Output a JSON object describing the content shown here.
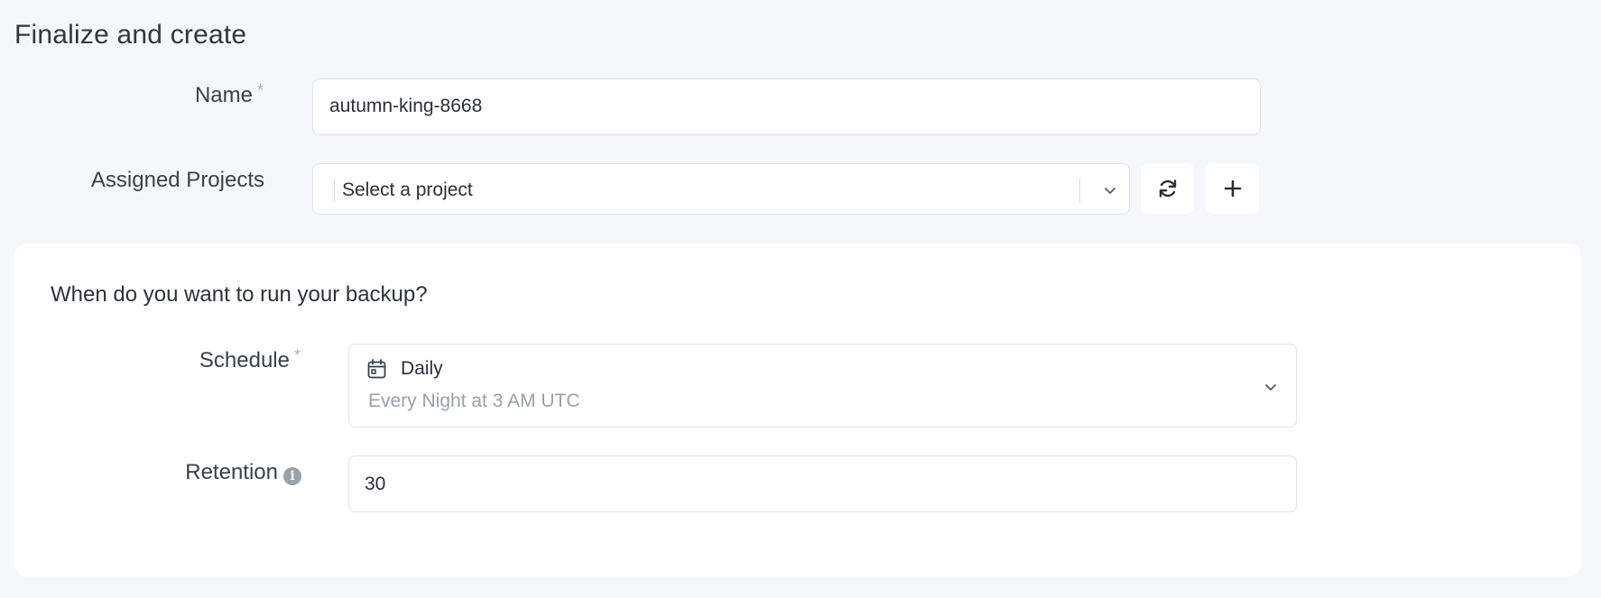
{
  "page": {
    "title": "Finalize and create"
  },
  "name_field": {
    "label": "Name",
    "required_mark": "*",
    "value": "autumn-king-8668"
  },
  "projects_field": {
    "label": "Assigned Projects",
    "placeholder": "Select a project",
    "refresh_icon": "refresh-icon",
    "add_icon": "plus-icon"
  },
  "backup_section": {
    "title": "When do you want to run your backup?",
    "schedule": {
      "label": "Schedule",
      "required_mark": "*",
      "icon": "calendar-icon",
      "selected_value": "Daily",
      "description": "Every Night at 3 AM UTC"
    },
    "retention": {
      "label": "Retention",
      "info_icon": "info-icon",
      "value": "30"
    }
  },
  "colors": {
    "page_background": "#f5f7fa",
    "card_background": "#ffffff",
    "border": "#dfe3e8",
    "muted_text": "#9aa1a9"
  }
}
